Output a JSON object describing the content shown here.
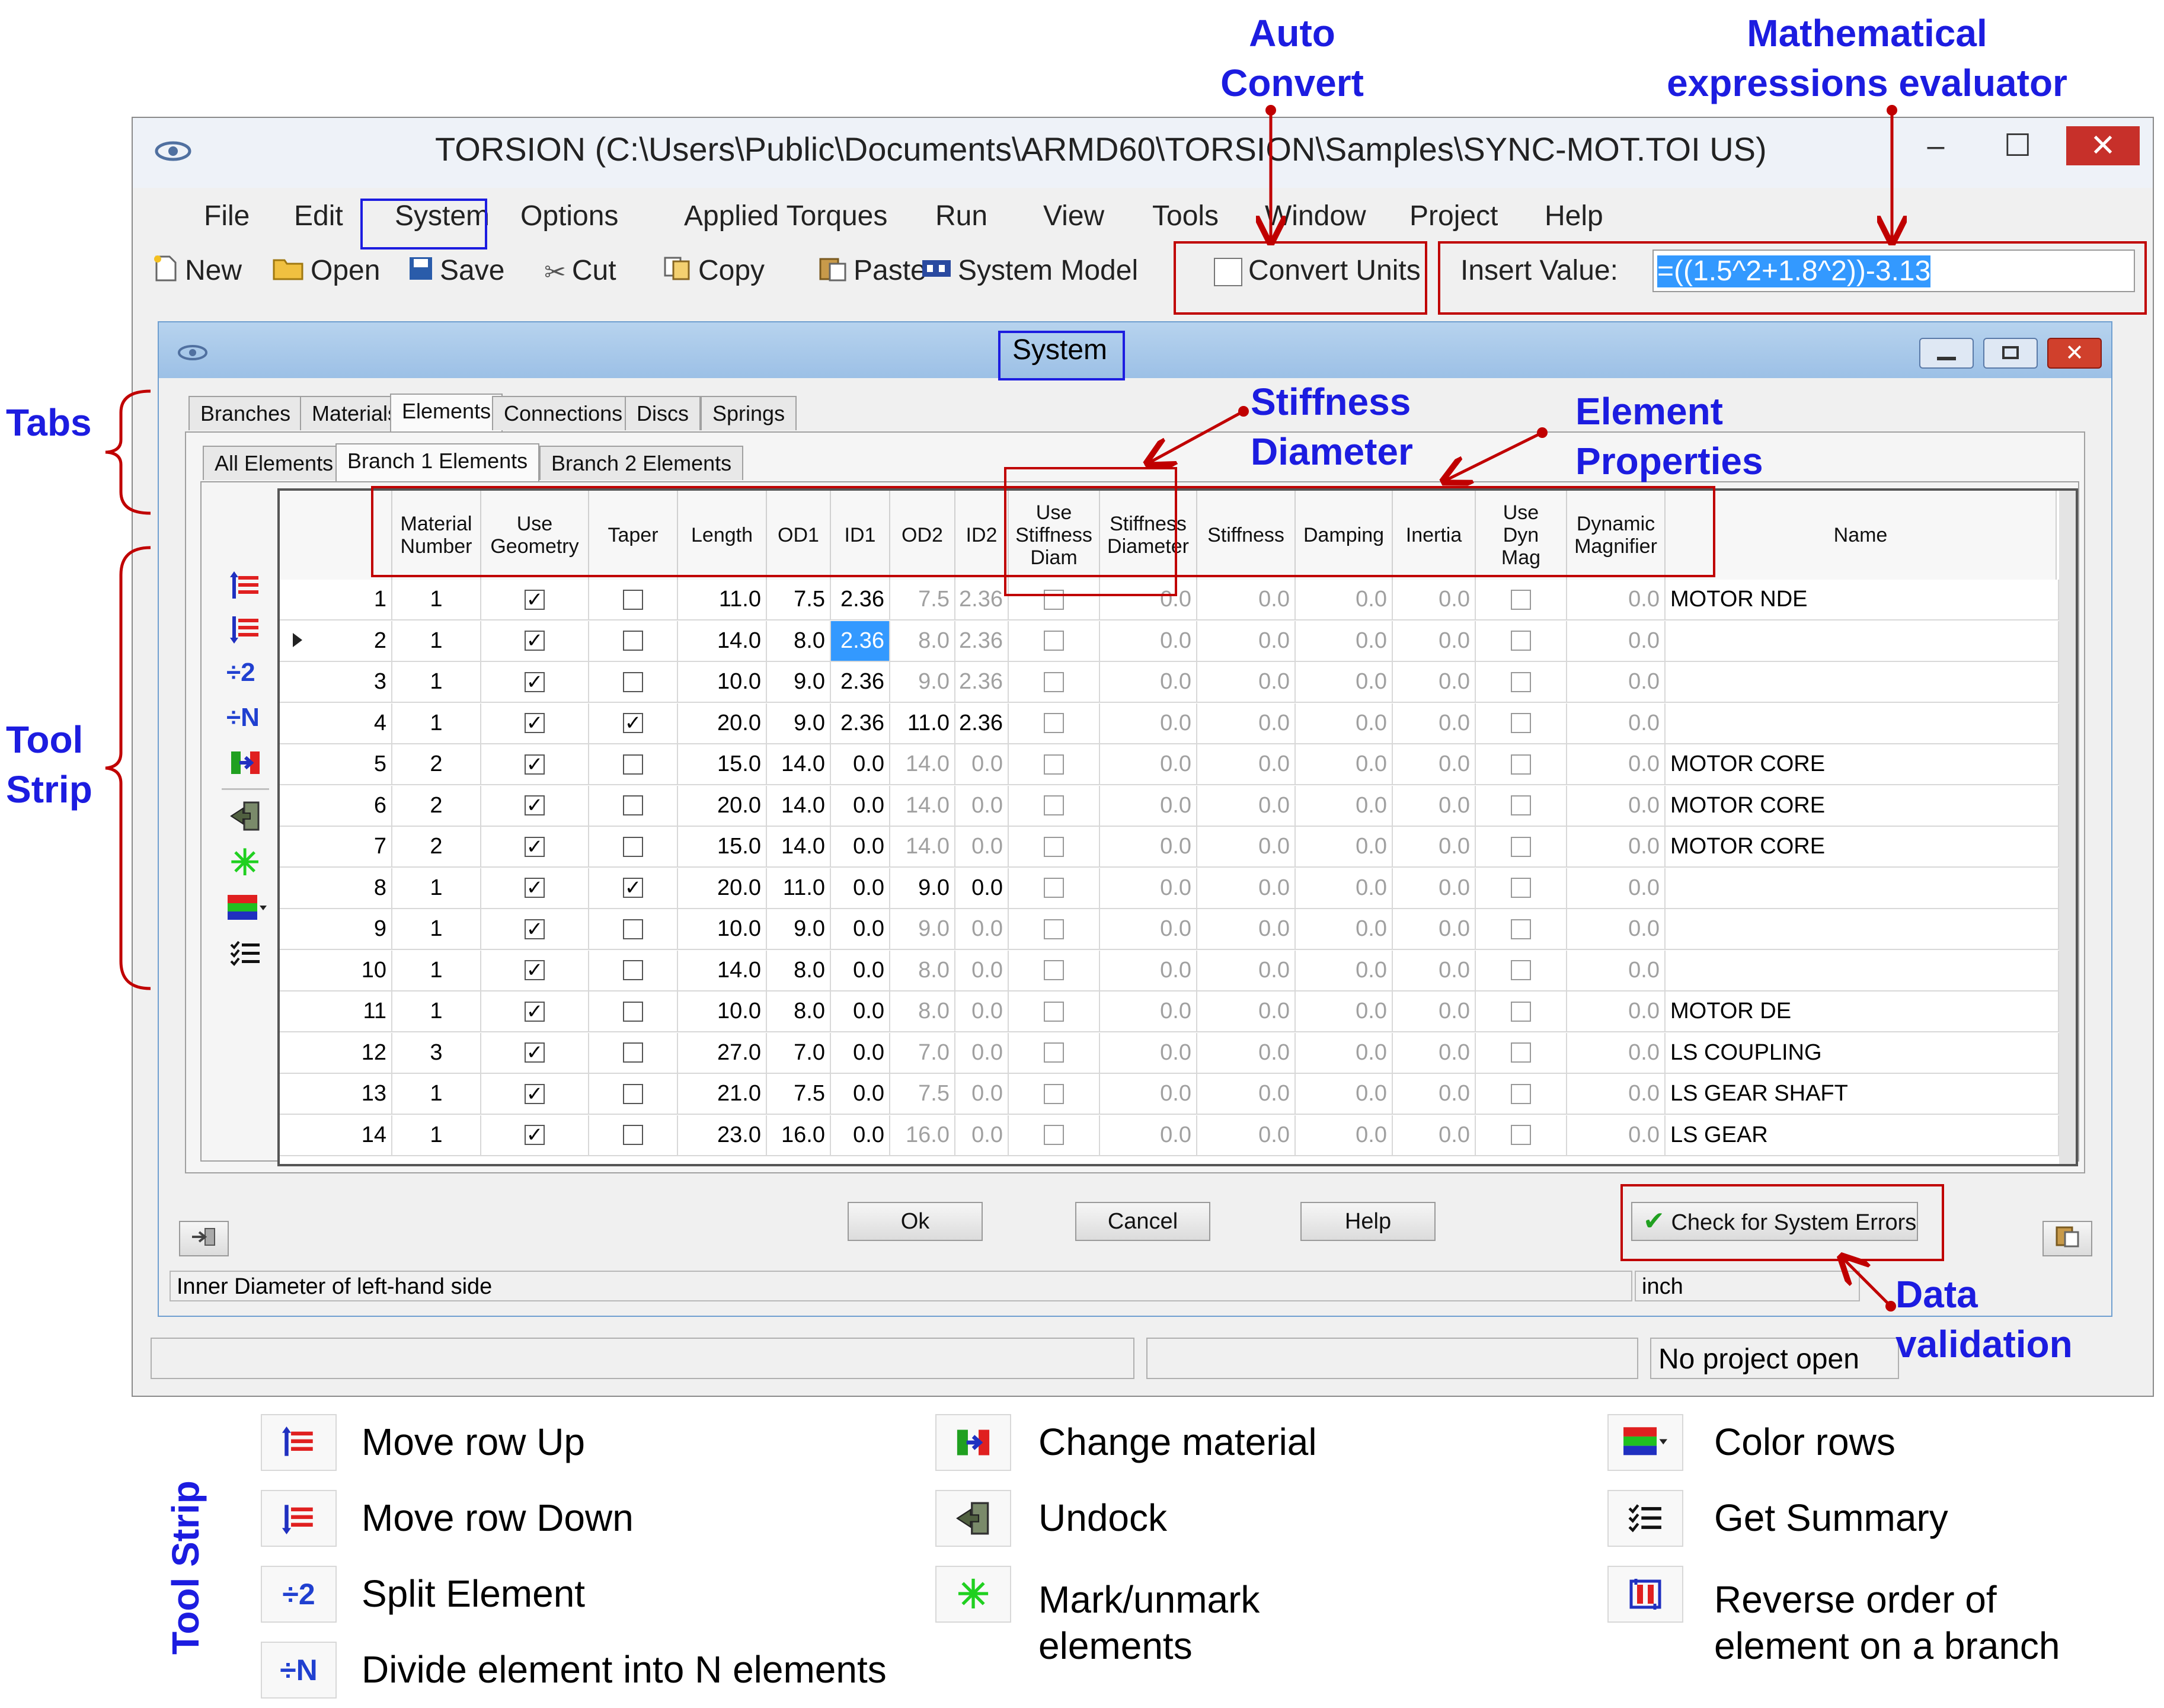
{
  "annotations": {
    "auto_convert": [
      "Auto",
      "Convert"
    ],
    "math_eval": [
      "Mathematical",
      "expressions evaluator"
    ],
    "tabs": "Tabs",
    "tool_strip": [
      "Tool",
      "Strip"
    ],
    "stiffness_diameter": [
      "Stiffness",
      "Diameter"
    ],
    "element_properties": [
      "Element",
      "Properties"
    ],
    "data_validation": [
      "Data",
      "validation"
    ],
    "legend_title": "Tool Strip"
  },
  "window": {
    "title": "TORSION (C:\\Users\\Public\\Documents\\ARMD60\\TORSION\\Samples\\SYNC-MOT.TOI US)",
    "minimize": "–",
    "maximize": "☐",
    "close": "✕"
  },
  "menu": [
    "File",
    "Edit",
    "System",
    "Options",
    "Applied Torques",
    "Run",
    "View",
    "Tools",
    "Window",
    "Project",
    "Help"
  ],
  "toolbar": {
    "new": "New",
    "open": "Open",
    "save": "Save",
    "cut": "Cut",
    "copy": "Copy",
    "paste": "Paste",
    "system_model": "System Model",
    "convert_units": "Convert Units",
    "insert_label": "Insert Value:",
    "insert_value": "=((1.5^2+1.8^2))-3.13"
  },
  "dialog": {
    "title": "System",
    "tabs": [
      "Branches",
      "Materials",
      "Elements",
      "Connections",
      "Discs",
      "Springs"
    ],
    "subtabs": [
      "All Elements",
      "Branch 1 Elements",
      "Branch 2 Elements"
    ],
    "columns": [
      "Material\nNumber",
      "Use\nGeometry",
      "Taper",
      "Length",
      "OD1",
      "ID1",
      "OD2",
      "ID2",
      "Use\nStiffness\nDiam",
      "Stiffness\nDiameter",
      "Stiffness",
      "Damping",
      "Inertia",
      "Use\nDyn\nMag",
      "Dynamic\nMagnifier",
      "Name"
    ],
    "rows": [
      {
        "n": "1",
        "mat": "1",
        "geo": true,
        "taper": false,
        "len": "11.0",
        "od1": "7.5",
        "id1": "2.36",
        "od2": "7.5",
        "id2": "2.36",
        "sd": "0.0",
        "stiff": "0.0",
        "damp": "0.0",
        "inertia": "0.0",
        "dm": "0.0",
        "name": "MOTOR NDE"
      },
      {
        "n": "2",
        "mat": "1",
        "geo": true,
        "taper": false,
        "len": "14.0",
        "od1": "8.0",
        "id1": "2.36",
        "od2": "8.0",
        "id2": "2.36",
        "sd": "0.0",
        "stiff": "0.0",
        "damp": "0.0",
        "inertia": "0.0",
        "dm": "0.0",
        "name": ""
      },
      {
        "n": "3",
        "mat": "1",
        "geo": true,
        "taper": false,
        "len": "10.0",
        "od1": "9.0",
        "id1": "2.36",
        "od2": "9.0",
        "id2": "2.36",
        "sd": "0.0",
        "stiff": "0.0",
        "damp": "0.0",
        "inertia": "0.0",
        "dm": "0.0",
        "name": ""
      },
      {
        "n": "4",
        "mat": "1",
        "geo": true,
        "taper": true,
        "len": "20.0",
        "od1": "9.0",
        "id1": "2.36",
        "od2": "11.0",
        "id2": "2.36",
        "sd": "0.0",
        "stiff": "0.0",
        "damp": "0.0",
        "inertia": "0.0",
        "dm": "0.0",
        "name": ""
      },
      {
        "n": "5",
        "mat": "2",
        "geo": true,
        "taper": false,
        "len": "15.0",
        "od1": "14.0",
        "id1": "0.0",
        "od2": "14.0",
        "id2": "0.0",
        "sd": "0.0",
        "stiff": "0.0",
        "damp": "0.0",
        "inertia": "0.0",
        "dm": "0.0",
        "name": "MOTOR CORE"
      },
      {
        "n": "6",
        "mat": "2",
        "geo": true,
        "taper": false,
        "len": "20.0",
        "od1": "14.0",
        "id1": "0.0",
        "od2": "14.0",
        "id2": "0.0",
        "sd": "0.0",
        "stiff": "0.0",
        "damp": "0.0",
        "inertia": "0.0",
        "dm": "0.0",
        "name": "MOTOR CORE"
      },
      {
        "n": "7",
        "mat": "2",
        "geo": true,
        "taper": false,
        "len": "15.0",
        "od1": "14.0",
        "id1": "0.0",
        "od2": "14.0",
        "id2": "0.0",
        "sd": "0.0",
        "stiff": "0.0",
        "damp": "0.0",
        "inertia": "0.0",
        "dm": "0.0",
        "name": "MOTOR CORE"
      },
      {
        "n": "8",
        "mat": "1",
        "geo": true,
        "taper": true,
        "len": "20.0",
        "od1": "11.0",
        "id1": "0.0",
        "od2": "9.0",
        "id2": "0.0",
        "sd": "0.0",
        "stiff": "0.0",
        "damp": "0.0",
        "inertia": "0.0",
        "dm": "0.0",
        "name": ""
      },
      {
        "n": "9",
        "mat": "1",
        "geo": true,
        "taper": false,
        "len": "10.0",
        "od1": "9.0",
        "id1": "0.0",
        "od2": "9.0",
        "id2": "0.0",
        "sd": "0.0",
        "stiff": "0.0",
        "damp": "0.0",
        "inertia": "0.0",
        "dm": "0.0",
        "name": ""
      },
      {
        "n": "10",
        "mat": "1",
        "geo": true,
        "taper": false,
        "len": "14.0",
        "od1": "8.0",
        "id1": "0.0",
        "od2": "8.0",
        "id2": "0.0",
        "sd": "0.0",
        "stiff": "0.0",
        "damp": "0.0",
        "inertia": "0.0",
        "dm": "0.0",
        "name": ""
      },
      {
        "n": "11",
        "mat": "1",
        "geo": true,
        "taper": false,
        "len": "10.0",
        "od1": "8.0",
        "id1": "0.0",
        "od2": "8.0",
        "id2": "0.0",
        "sd": "0.0",
        "stiff": "0.0",
        "damp": "0.0",
        "inertia": "0.0",
        "dm": "0.0",
        "name": "MOTOR DE"
      },
      {
        "n": "12",
        "mat": "3",
        "geo": true,
        "taper": false,
        "len": "27.0",
        "od1": "7.0",
        "id1": "0.0",
        "od2": "7.0",
        "id2": "0.0",
        "sd": "0.0",
        "stiff": "0.0",
        "damp": "0.0",
        "inertia": "0.0",
        "dm": "0.0",
        "name": "LS COUPLING"
      },
      {
        "n": "13",
        "mat": "1",
        "geo": true,
        "taper": false,
        "len": "21.0",
        "od1": "7.5",
        "id1": "0.0",
        "od2": "7.5",
        "id2": "0.0",
        "sd": "0.0",
        "stiff": "0.0",
        "damp": "0.0",
        "inertia": "0.0",
        "dm": "0.0",
        "name": "LS GEAR SHAFT"
      },
      {
        "n": "14",
        "mat": "1",
        "geo": true,
        "taper": false,
        "len": "23.0",
        "od1": "16.0",
        "id1": "0.0",
        "od2": "16.0",
        "id2": "0.0",
        "sd": "0.0",
        "stiff": "0.0",
        "damp": "0.0",
        "inertia": "0.0",
        "dm": "0.0",
        "name": "LS GEAR"
      }
    ],
    "buttons": {
      "ok": "Ok",
      "cancel": "Cancel",
      "help": "Help",
      "check": "Check for System Errors"
    },
    "status_left": "Inner Diameter of left-hand side",
    "status_right": "inch"
  },
  "statusbar": {
    "project": "No project open"
  },
  "tool_strip_glyphs": {
    "split2": "÷2",
    "splitN": "÷N"
  },
  "legend": {
    "col1": [
      "Move row Up",
      "Move row Down",
      "Split Element",
      "Divide element into N elements"
    ],
    "col2": [
      "Change material",
      "Undock",
      "Mark/unmark",
      "elements"
    ],
    "col3": [
      "Color rows",
      "Get Summary",
      "Reverse order of",
      "element on a branch"
    ]
  },
  "colors": {
    "annotation_blue": "#1c1ce0",
    "highlight_red": "#c00000",
    "selection_blue": "#3399ff",
    "close_red": "#c7302a"
  }
}
